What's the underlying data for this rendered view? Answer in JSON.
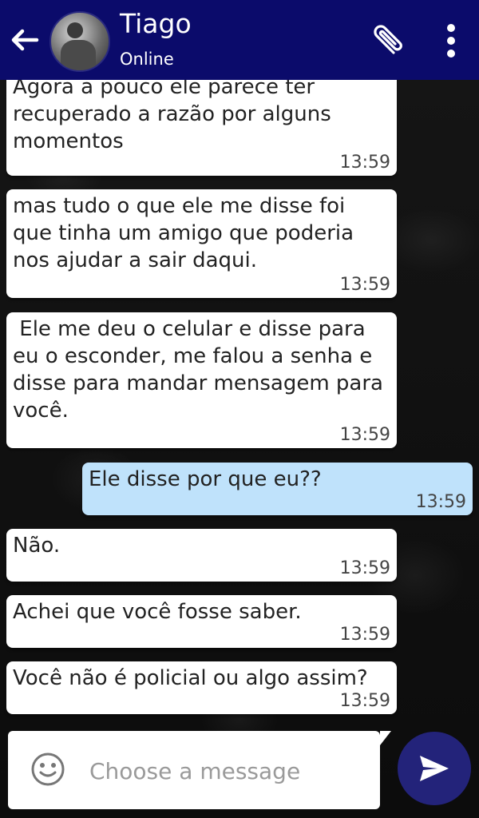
{
  "header": {
    "contact_name": "Tiago",
    "status": "Online",
    "colors": {
      "bar": "#0b0b6b"
    }
  },
  "messages": [
    {
      "direction": "in",
      "text": "Agora a pouco ele parece ter recuperado a razão por alguns momentos",
      "time": "13:59"
    },
    {
      "direction": "in",
      "text": "mas tudo o que ele me disse foi que tinha um amigo que poderia nos ajudar a sair daqui.",
      "time": "13:59"
    },
    {
      "direction": "in",
      "text": " Ele me deu o celular e disse para eu o esconder, me falou a senha e disse para mandar mensagem para você.",
      "time": "13:59"
    },
    {
      "direction": "out",
      "text": "Ele disse por que eu??",
      "time": "13:59"
    },
    {
      "direction": "in",
      "text": "Não.",
      "time": "13:59"
    },
    {
      "direction": "in",
      "text": "Achei que você fosse saber.",
      "time": "13:59"
    },
    {
      "direction": "in",
      "text": "Você não é policial ou algo assim?",
      "time": "13:59"
    }
  ],
  "composer": {
    "placeholder": "Choose a message",
    "emoji_icon": "smiley-icon",
    "send_icon": "send-icon"
  }
}
